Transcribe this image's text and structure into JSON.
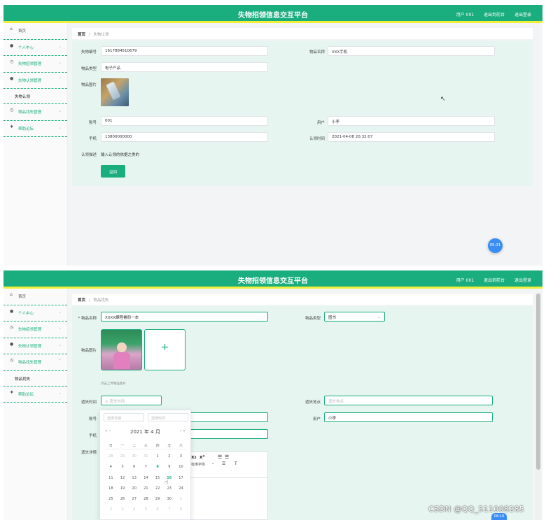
{
  "app_title": "失物招领信息交互平台",
  "header_links": [
    "用户 001",
    "退出到前台",
    "退出登录"
  ],
  "screen1": {
    "sidebar": {
      "home": "首页",
      "items": [
        "个人中心",
        "失物招领管理",
        "失物认领管理"
      ],
      "sub_item": "失物认领",
      "items_after": [
        "物品找失管理",
        "帮助论坛"
      ]
    },
    "breadcrumb": {
      "home": "首页",
      "sep": "/",
      "current": "失物认领"
    },
    "form": {
      "lost_no_label": "失物编号",
      "lost_no_value": "1617884510679",
      "item_name_label": "物品名称",
      "item_name_value": "XXX手机",
      "item_type_label": "物品类型",
      "item_type_value": "电子产品",
      "item_image_label": "物品图片",
      "account_label": "账号",
      "account_value": "001",
      "user_label": "用户",
      "user_value": "小李",
      "phone_label": "手机",
      "phone_value": "13800000000",
      "claim_time_label": "认领时间",
      "claim_time_value": "2021-04-08 20:32:07",
      "desc_label": "认领描述",
      "desc_value": "输入认领的依据之类的"
    },
    "back_button": "返回",
    "timer": "05:31"
  },
  "screen2": {
    "sidebar": {
      "home": "首页",
      "items": [
        "个人中心",
        "失物招领管理",
        "失物认领管理",
        "物品找失管理"
      ],
      "sub_item": "物品找失",
      "items_after": [
        "帮助论坛"
      ]
    },
    "breadcrumb": {
      "home": "首页",
      "sep": "/",
      "current": "物品找失"
    },
    "form": {
      "item_name_label": "* 物品名称",
      "item_name_value": "XXXX課程書冊一本",
      "item_type_label": "物品类型",
      "item_type_value": "图书",
      "item_image_label": "物品图片",
      "upload_plus": "+",
      "upload_hint": "点击上传物品图片",
      "lost_time_label": "遗失时间",
      "lost_time_placeholder": "⊙ 遗失时间",
      "lost_place_label": "遗失地点",
      "lost_place_placeholder": "遗失地点",
      "account_label": "账号",
      "user_label": "用户",
      "user_value": "小李",
      "phone_label": "手机",
      "detail_label": "遗失详情",
      "editor_tools": [
        "x₂",
        "x²",
        "☰",
        "☰"
      ],
      "editor_font": "标准字体"
    },
    "calendar": {
      "date_placeholder": "选择日期",
      "time_placeholder": "选择时间",
      "prev": "« ‹",
      "next": "› »",
      "header": "2021 年  4 月",
      "weekdays": [
        "日",
        "一",
        "二",
        "三",
        "四",
        "五",
        "六"
      ],
      "weeks": [
        [
          "28",
          "29",
          "30",
          "31",
          "1",
          "2",
          "3"
        ],
        [
          "4",
          "5",
          "6",
          "7",
          "8",
          "9",
          "10"
        ],
        [
          "11",
          "12",
          "13",
          "14",
          "15",
          "16",
          "17"
        ],
        [
          "18",
          "19",
          "20",
          "21",
          "22",
          "23",
          "24"
        ],
        [
          "25",
          "26",
          "27",
          "28",
          "29",
          "30",
          "1"
        ],
        [
          "2",
          "3",
          "4",
          "5",
          "6",
          "7",
          "8"
        ]
      ]
    },
    "timer": "06:10"
  },
  "watermark": "CSDN @QQ_511008285"
}
